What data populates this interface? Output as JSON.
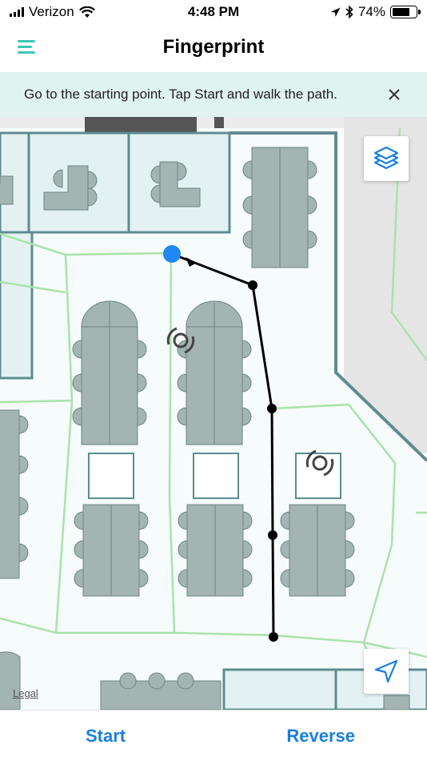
{
  "status_bar": {
    "carrier": "Verizon",
    "time": "4:48 PM",
    "battery_percent": "74%",
    "battery_level": 0.74
  },
  "nav": {
    "title": "Fingerprint",
    "menu_icon": "hamburger-menu-icon"
  },
  "banner": {
    "message": "Go to the starting point. Tap Start and walk the path.",
    "close_icon": "close-icon"
  },
  "map": {
    "layers_icon": "layers-icon",
    "locate_icon": "location-arrow-icon",
    "legal_label": "Legal"
  },
  "toolbar": {
    "start_label": "Start",
    "reverse_label": "Reverse"
  },
  "colors": {
    "accent": "#1a7fe0",
    "menu_teal": "#3cc7b5",
    "banner_bg": "#dff3ef",
    "walls": "#5e8c8f",
    "rooms": "#e3f1f3",
    "furniture": "#a4b4b2",
    "corridor_lines": "#a9e3a9",
    "start_point": "#1e88f5"
  }
}
